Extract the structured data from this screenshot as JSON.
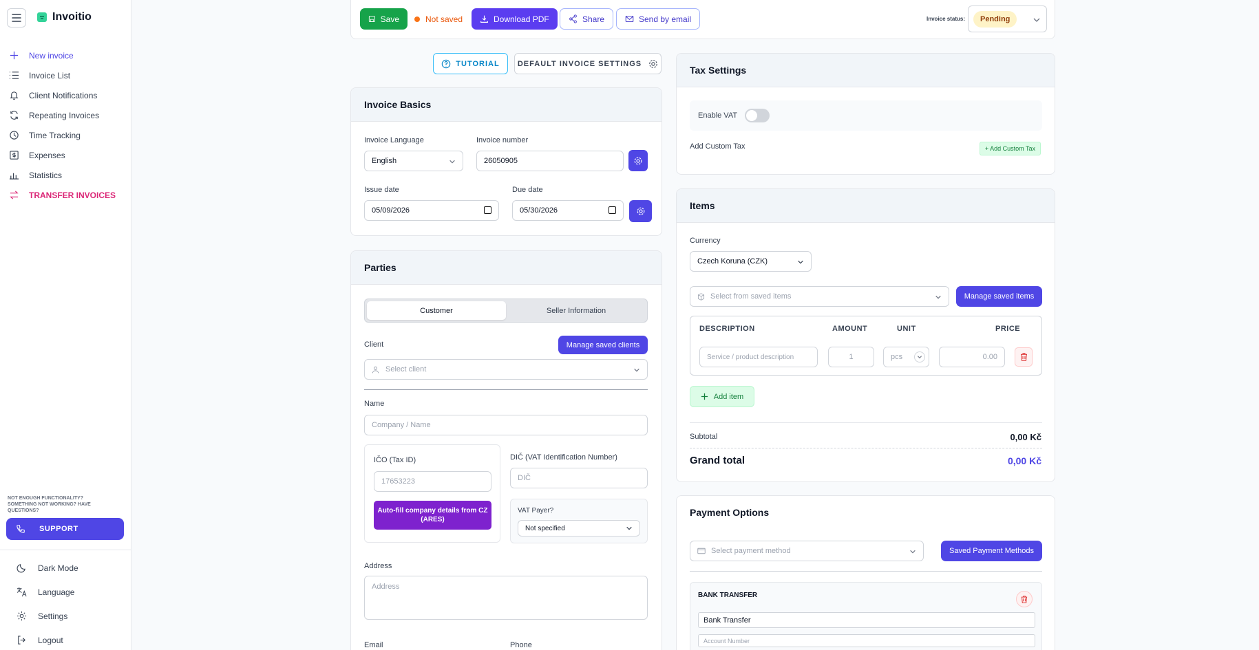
{
  "app": {
    "name": "Invoitio"
  },
  "sidebar": {
    "items": [
      {
        "label": "New invoice",
        "icon": "plus-icon"
      },
      {
        "label": "Invoice List",
        "icon": "list-icon"
      },
      {
        "label": "Client Notifications",
        "icon": "bell-icon"
      },
      {
        "label": "Repeating Invoices",
        "icon": "repeat-icon"
      },
      {
        "label": "Time Tracking",
        "icon": "clock-icon"
      },
      {
        "label": "Expenses",
        "icon": "dollar-icon"
      },
      {
        "label": "Statistics",
        "icon": "bar-chart-icon"
      },
      {
        "label": "TRANSFER INVOICES",
        "icon": "transfer-icon"
      }
    ],
    "support_note": "NOT ENOUGH FUNCTIONALITY? SOMETHING NOT WORKING? HAVE QUESTIONS?",
    "support_label": "SUPPORT",
    "bottom": [
      {
        "label": "Dark Mode",
        "icon": "moon-icon"
      },
      {
        "label": "Language",
        "icon": "translate-icon"
      },
      {
        "label": "Settings",
        "icon": "gear-icon"
      },
      {
        "label": "Logout",
        "icon": "logout-icon"
      }
    ]
  },
  "toolbar": {
    "save": "Save",
    "not_saved": "Not saved",
    "download_pdf": "Download PDF",
    "share": "Share",
    "send_email": "Send by email",
    "status_label": "Invoice status:",
    "status_value": "Pending"
  },
  "actions": {
    "tutorial": "TUTORIAL",
    "default_settings": "DEFAULT INVOICE SETTINGS"
  },
  "basics": {
    "title": "Invoice Basics",
    "language_label": "Invoice Language",
    "language_value": "English",
    "number_label": "Invoice number",
    "number_value": "26050905",
    "issue_label": "Issue date",
    "issue_value": "05/09/2026",
    "due_label": "Due date",
    "due_value": "05/30/2026"
  },
  "parties": {
    "title": "Parties",
    "tab_customer": "Customer",
    "tab_seller": "Seller Information",
    "client_label": "Client",
    "manage_clients": "Manage saved clients",
    "client_placeholder": "Select client",
    "name_label": "Name",
    "name_placeholder": "Company / Name",
    "ico_label": "IČO (Tax ID)",
    "ico_placeholder": "17653223",
    "autofill": "Auto-fill company details from CZ (ARES)",
    "dic_label": "DIČ (VAT Identification Number)",
    "dic_placeholder": "DIČ",
    "vat_payer_label": "VAT Payer?",
    "vat_payer_value": "Not specified",
    "address_label": "Address",
    "address_placeholder": "Address",
    "email_label": "Email",
    "phone_label": "Phone"
  },
  "tax": {
    "title": "Tax Settings",
    "enable_vat": "Enable VAT",
    "custom_tax_label": "Add Custom Tax",
    "add_custom_tax": "+ Add Custom Tax"
  },
  "items": {
    "title": "Items",
    "currency_label": "Currency",
    "currency_value": "Czech Koruna (CZK)",
    "saved_items_placeholder": "Select from saved items",
    "manage_saved_items": "Manage saved items",
    "columns": [
      "DESCRIPTION",
      "AMOUNT",
      "UNIT",
      "PRICE"
    ],
    "row": {
      "desc_placeholder": "Service / product description",
      "amount": "1",
      "unit": "pcs",
      "price": "0.00"
    },
    "add_item": "Add item",
    "subtotal_label": "Subtotal",
    "subtotal_value": "0,00 Kč",
    "grand_total_label": "Grand total",
    "grand_total_value": "0,00 Kč"
  },
  "payment": {
    "title": "Payment Options",
    "method_placeholder": "Select payment method",
    "saved_methods": "Saved Payment Methods",
    "bank_title": "BANK TRANSFER",
    "bank_name_value": "Bank Transfer",
    "account_placeholder": "Account Number"
  },
  "colors": {
    "primary": "#4f46e5",
    "save": "#16a34a",
    "pdf": "#5b3df0",
    "transfer": "#db2777",
    "pending_bg": "#fef3c7"
  }
}
